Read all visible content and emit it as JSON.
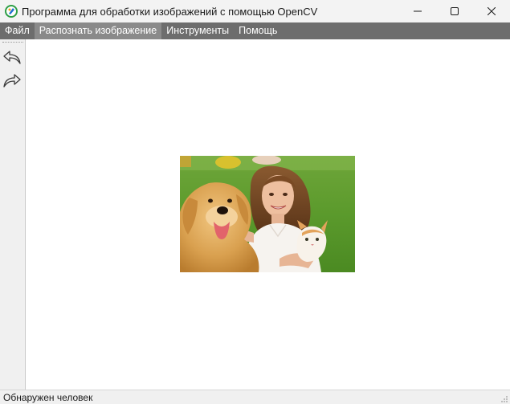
{
  "window": {
    "title": "Программа для обработки изображений с помощью OpenCV"
  },
  "menu": {
    "items": [
      {
        "label": "Файл"
      },
      {
        "label": "Распознать изображение"
      },
      {
        "label": "Инструменты"
      },
      {
        "label": "Помощь"
      }
    ],
    "active_index": 1
  },
  "toolbar": {
    "buttons": [
      {
        "icon": "undo-icon"
      },
      {
        "icon": "redo-icon"
      }
    ]
  },
  "canvas": {
    "image_description_icon": "photo-image"
  },
  "status": {
    "text": "Обнаружен человек"
  },
  "colors": {
    "titlebar": "#f3f3f3",
    "menubar": "#6d6d6d",
    "menu_active": "#8a8a8a",
    "toolbar": "#f0f0f0",
    "app_icon_ring": "#2e9e46"
  }
}
